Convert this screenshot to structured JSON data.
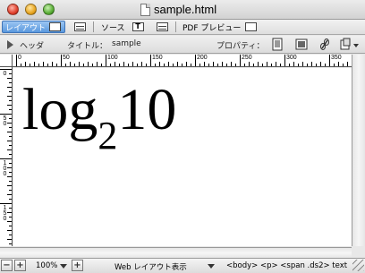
{
  "window": {
    "title": "sample.html"
  },
  "modebar": {
    "layout_label": "レイアウト",
    "source_label": "ソース",
    "pdf_label": "PDF プレビュー"
  },
  "propbar": {
    "header_label": "ヘッダ",
    "title_label": "タイトル：",
    "title_value": "sample",
    "properties_label": "プロパティ："
  },
  "ruler": {
    "top_marks": [
      "0",
      "50",
      "100",
      "150",
      "200",
      "250",
      "300",
      "350"
    ],
    "left_marks": [
      "0",
      "50",
      "100",
      "150"
    ]
  },
  "content": {
    "formula_base": "log",
    "formula_sub": "2",
    "formula_arg": "10"
  },
  "statusbar": {
    "zoom_value": "100%",
    "view_mode": "Web レイアウト表示",
    "path": "<body> <p> <span .ds2> text"
  }
}
